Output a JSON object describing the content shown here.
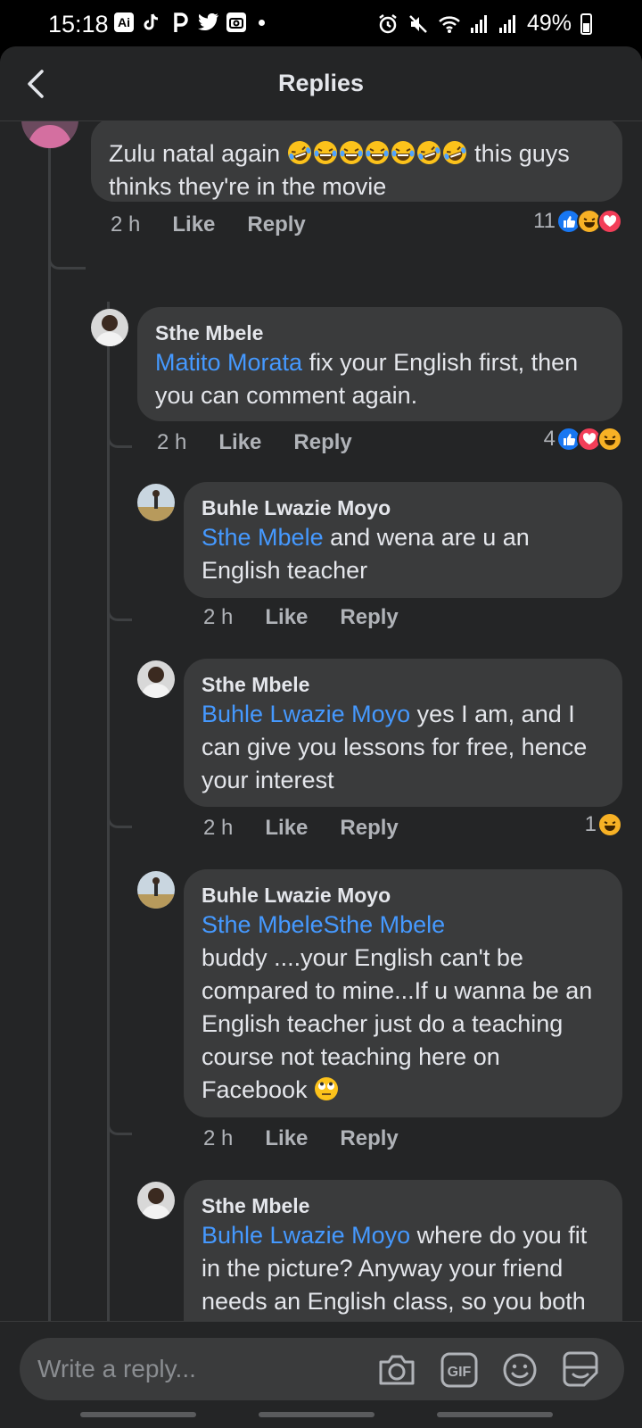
{
  "status_bar": {
    "time": "15:18",
    "left_icons": [
      "ai-icon",
      "tiktok-icon",
      "pinterest-icon",
      "twitter-icon",
      "camera-app-icon",
      "dot-icon"
    ],
    "right_icons": [
      "alarm-icon",
      "mute-icon",
      "wifi-icon",
      "signal-icon",
      "signal-icon"
    ],
    "battery": "49%"
  },
  "header": {
    "title": "Replies",
    "back_icon": "chevron-left-icon"
  },
  "comments": [
    {
      "text": "Zulu natal again",
      "emojis": 7,
      "text_after": "this guys thinks they're in the movie",
      "time": "2 h",
      "like": "Like",
      "reply": "Reply",
      "reaction_count": "11",
      "reactions": [
        "like",
        "haha",
        "love"
      ]
    },
    {
      "author": "Sthe Mbele",
      "mention": "Matito Morata",
      "text": " fix your English first, then you can comment again.",
      "time": "2 h",
      "like": "Like",
      "reply": "Reply",
      "reaction_count": "4",
      "reactions": [
        "like",
        "love",
        "haha"
      ]
    },
    {
      "author": "Buhle Lwazie Moyo",
      "mention": "Sthe Mbele",
      "text": " and wena are u an English teacher",
      "time": "2 h",
      "like": "Like",
      "reply": "Reply"
    },
    {
      "author": "Sthe Mbele",
      "mention": "Buhle Lwazie Moyo",
      "text": " yes I am, and I can give you lessons for free, hence your interest",
      "time": "2 h",
      "like": "Like",
      "reply": "Reply",
      "reaction_count": "1",
      "reactions": [
        "haha"
      ]
    },
    {
      "author": "Buhle Lwazie Moyo",
      "mention": "Sthe MbeleSthe Mbele",
      "text": "buddy ....your English can't be compared to mine...If u wanna be an English teacher just do a teaching course not teaching here on Facebook",
      "emoji": "eye-roll",
      "time": "2 h",
      "like": "Like",
      "reply": "Reply"
    },
    {
      "author": "Sthe Mbele",
      "mention": "Buhle Lwazie Moyo",
      "text": " where do you fit in the picture?  Anyway your friend needs an English class, so you both can compare your"
    }
  ],
  "composer": {
    "placeholder": "Write a reply...",
    "buttons": [
      "camera-icon",
      "gif-icon",
      "emoji-icon",
      "sticker-icon"
    ]
  },
  "colors": {
    "background": "#242526",
    "bubble": "#3a3b3c",
    "text": "#e4e6eb",
    "muted": "#b0b3b8",
    "mention": "#4599ff",
    "like": "#1877f2",
    "love": "#f33e58",
    "haha": "#f7b125"
  }
}
